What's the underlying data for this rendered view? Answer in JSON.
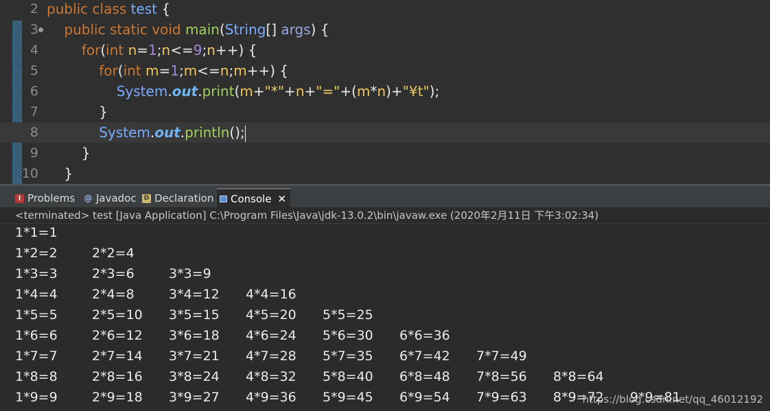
{
  "editor": {
    "lines": [
      {
        "num": "2",
        "tokens": [
          [
            "kw",
            "public "
          ],
          [
            "kw",
            "class "
          ],
          [
            "cls",
            "test "
          ],
          [
            "plain",
            "{"
          ]
        ]
      },
      {
        "num": "3",
        "fold": true,
        "tokens": [
          [
            "plain",
            "    "
          ],
          [
            "kw",
            "public "
          ],
          [
            "kw",
            "static "
          ],
          [
            "kw",
            "void "
          ],
          [
            "meth",
            "main"
          ],
          [
            "plain",
            "("
          ],
          [
            "cls",
            "String"
          ],
          [
            "plain",
            "[] "
          ],
          [
            "param",
            "args"
          ],
          [
            "plain",
            ") {"
          ]
        ]
      },
      {
        "num": "4",
        "tokens": [
          [
            "plain",
            "        "
          ],
          [
            "kw",
            "for"
          ],
          [
            "plain",
            "("
          ],
          [
            "kw",
            "int "
          ],
          [
            "var",
            "n"
          ],
          [
            "plain",
            "="
          ],
          [
            "num",
            "1"
          ],
          [
            "plain",
            ";"
          ],
          [
            "var",
            "n"
          ],
          [
            "plain",
            "<="
          ],
          [
            "num",
            "9"
          ],
          [
            "plain",
            ";"
          ],
          [
            "var",
            "n"
          ],
          [
            "plain",
            "++) {"
          ]
        ]
      },
      {
        "num": "5",
        "tokens": [
          [
            "plain",
            "            "
          ],
          [
            "kw",
            "for"
          ],
          [
            "plain",
            "("
          ],
          [
            "kw",
            "int "
          ],
          [
            "var",
            "m"
          ],
          [
            "plain",
            "="
          ],
          [
            "num",
            "1"
          ],
          [
            "plain",
            ";"
          ],
          [
            "var",
            "m"
          ],
          [
            "plain",
            "<="
          ],
          [
            "var",
            "n"
          ],
          [
            "plain",
            ";"
          ],
          [
            "var",
            "m"
          ],
          [
            "plain",
            "++) {"
          ]
        ]
      },
      {
        "num": "6",
        "tokens": [
          [
            "plain",
            "                "
          ],
          [
            "cls",
            "System"
          ],
          [
            "plain",
            "."
          ],
          [
            "field",
            "out"
          ],
          [
            "plain",
            "."
          ],
          [
            "meth",
            "print"
          ],
          [
            "plain",
            "("
          ],
          [
            "var",
            "m"
          ],
          [
            "plain",
            "+"
          ],
          [
            "str",
            "\"*\""
          ],
          [
            "plain",
            "+"
          ],
          [
            "var",
            "n"
          ],
          [
            "plain",
            "+"
          ],
          [
            "str",
            "\"=\""
          ],
          [
            "plain",
            "+("
          ],
          [
            "var",
            "m"
          ],
          [
            "plain",
            "*"
          ],
          [
            "var",
            "n"
          ],
          [
            "plain",
            ")+"
          ],
          [
            "str",
            "\"¥t\""
          ],
          [
            "plain",
            ");"
          ]
        ]
      },
      {
        "num": "7",
        "tokens": [
          [
            "plain",
            "            }"
          ]
        ]
      },
      {
        "num": "8",
        "current": true,
        "tokens": [
          [
            "plain",
            "            "
          ],
          [
            "cls",
            "System"
          ],
          [
            "plain",
            "."
          ],
          [
            "field",
            "out"
          ],
          [
            "plain",
            "."
          ],
          [
            "meth",
            "println"
          ],
          [
            "plain",
            "();"
          ]
        ]
      },
      {
        "num": "9",
        "tokens": [
          [
            "plain",
            "        }"
          ]
        ]
      },
      {
        "num": "10",
        "tokens": [
          [
            "plain",
            "    }"
          ]
        ]
      }
    ]
  },
  "tabs": [
    {
      "id": "problems",
      "label": "Problems",
      "icon": "problems-icon"
    },
    {
      "id": "javadoc",
      "label": "Javadoc",
      "icon": "javadoc-icon"
    },
    {
      "id": "declaration",
      "label": "Declaration",
      "icon": "declaration-icon"
    },
    {
      "id": "console",
      "label": "Console",
      "icon": "console-icon",
      "active": true,
      "close": "✕"
    }
  ],
  "console": {
    "header": "<terminated> test [Java Application] C:\\Program Files\\Java\\jdk-13.0.2\\bin\\javaw.exe (2020年2月11日 下午3:02:34)",
    "rows": [
      [
        "1*1=1"
      ],
      [
        "1*2=2",
        "2*2=4"
      ],
      [
        "1*3=3",
        "2*3=6",
        "3*3=9"
      ],
      [
        "1*4=4",
        "2*4=8",
        "3*4=12",
        "4*4=16"
      ],
      [
        "1*5=5",
        "2*5=10",
        "3*5=15",
        "4*5=20",
        "5*5=25"
      ],
      [
        "1*6=6",
        "2*6=12",
        "3*6=18",
        "4*6=24",
        "5*6=30",
        "6*6=36"
      ],
      [
        "1*7=7",
        "2*7=14",
        "3*7=21",
        "4*7=28",
        "5*7=35",
        "6*7=42",
        "7*7=49"
      ],
      [
        "1*8=8",
        "2*8=16",
        "3*8=24",
        "4*8=32",
        "5*8=40",
        "6*8=48",
        "7*8=56",
        "8*8=64"
      ],
      [
        "1*9=9",
        "2*9=18",
        "3*9=27",
        "4*9=36",
        "5*9=45",
        "6*9=54",
        "7*9=63",
        "8*9=72",
        "9*9=81"
      ]
    ]
  },
  "watermark": "https://blog.csdn.net/qq_46012192"
}
